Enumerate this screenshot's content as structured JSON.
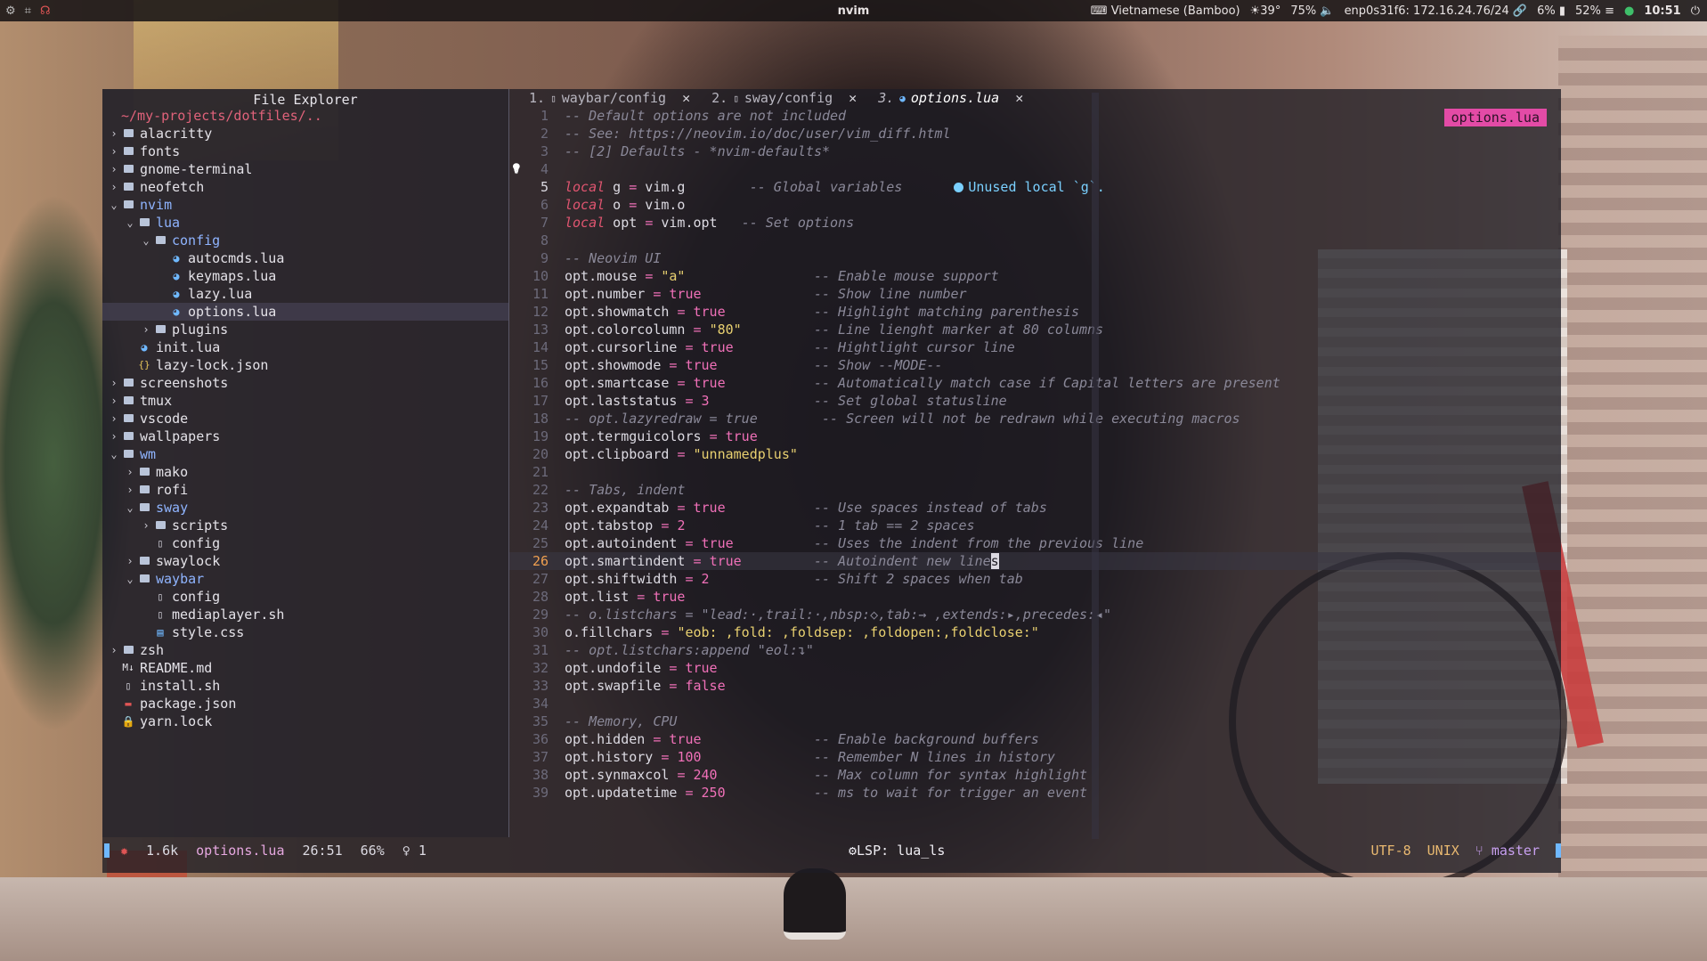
{
  "topbar": {
    "title": "nvim",
    "keyboard": "Vietnamese (Bamboo)",
    "weather": "☀39°",
    "volume": "75%",
    "network": "enp0s31f6: 172.16.24.76/24",
    "cpu": "6%",
    "battery": "52%",
    "clock": "10:51"
  },
  "explorer": {
    "title": "File Explorer",
    "path": "~/my-projects/dotfiles/..",
    "items": [
      {
        "name": "alacritty",
        "type": "dir",
        "open": false,
        "depth": 0
      },
      {
        "name": "fonts",
        "type": "dir",
        "open": false,
        "depth": 0
      },
      {
        "name": "gnome-terminal",
        "type": "dir",
        "open": false,
        "depth": 0
      },
      {
        "name": "neofetch",
        "type": "dir",
        "open": false,
        "depth": 0
      },
      {
        "name": "nvim",
        "type": "dir",
        "open": true,
        "depth": 0
      },
      {
        "name": "lua",
        "type": "dir",
        "open": true,
        "depth": 1
      },
      {
        "name": "config",
        "type": "dir",
        "open": true,
        "depth": 2
      },
      {
        "name": "autocmds.lua",
        "type": "lua",
        "depth": 3
      },
      {
        "name": "keymaps.lua",
        "type": "lua",
        "depth": 3
      },
      {
        "name": "lazy.lua",
        "type": "lua",
        "depth": 3
      },
      {
        "name": "options.lua",
        "type": "lua",
        "depth": 3,
        "active": true
      },
      {
        "name": "plugins",
        "type": "dir",
        "open": false,
        "depth": 2
      },
      {
        "name": "init.lua",
        "type": "lua",
        "depth": 1
      },
      {
        "name": "lazy-lock.json",
        "type": "json",
        "depth": 1
      },
      {
        "name": "screenshots",
        "type": "dir",
        "open": false,
        "depth": 0
      },
      {
        "name": "tmux",
        "type": "dir",
        "open": false,
        "depth": 0
      },
      {
        "name": "vscode",
        "type": "dir",
        "open": false,
        "depth": 0
      },
      {
        "name": "wallpapers",
        "type": "dir",
        "open": false,
        "depth": 0
      },
      {
        "name": "wm",
        "type": "dir",
        "open": true,
        "depth": 0
      },
      {
        "name": "mako",
        "type": "dir",
        "open": false,
        "depth": 1
      },
      {
        "name": "rofi",
        "type": "dir",
        "open": false,
        "depth": 1
      },
      {
        "name": "sway",
        "type": "dir",
        "open": true,
        "depth": 1
      },
      {
        "name": "scripts",
        "type": "dir",
        "open": false,
        "depth": 2
      },
      {
        "name": "config",
        "type": "file",
        "depth": 2
      },
      {
        "name": "swaylock",
        "type": "dir",
        "open": false,
        "depth": 1
      },
      {
        "name": "waybar",
        "type": "dir",
        "open": true,
        "depth": 1
      },
      {
        "name": "config",
        "type": "file",
        "depth": 2
      },
      {
        "name": "mediaplayer.sh",
        "type": "file",
        "depth": 2
      },
      {
        "name": "style.css",
        "type": "css",
        "depth": 2
      },
      {
        "name": "zsh",
        "type": "dir",
        "open": false,
        "depth": 0
      },
      {
        "name": "README.md",
        "type": "md",
        "depth": 0
      },
      {
        "name": "install.sh",
        "type": "file",
        "depth": 0
      },
      {
        "name": "package.json",
        "type": "npm",
        "depth": 0
      },
      {
        "name": "yarn.lock",
        "type": "lock",
        "depth": 0
      }
    ]
  },
  "tabs": [
    {
      "num": "1.",
      "label": "waybar/config",
      "close": "✕",
      "active": false
    },
    {
      "num": "2.",
      "label": "sway/config",
      "close": "✕",
      "active": false
    },
    {
      "num": "3.",
      "label": "options.lua",
      "close": "✕",
      "active": true
    }
  ],
  "badge": "options.lua",
  "diagnostic": "Unused local `g`.",
  "code": [
    {
      "n": "1",
      "t": [
        [
          "cm",
          "-- Default options are not included"
        ]
      ]
    },
    {
      "n": "2",
      "t": [
        [
          "cm",
          "-- See: https://neovim.io/doc/user/vim_diff.html"
        ]
      ]
    },
    {
      "n": "3",
      "t": [
        [
          "cm",
          "-- [2] Defaults - *nvim-defaults*"
        ]
      ]
    },
    {
      "n": "4",
      "t": []
    },
    {
      "n": "5",
      "t": [
        [
          "kw",
          "local"
        ],
        [
          "tx",
          " g "
        ],
        [
          "op",
          "="
        ],
        [
          "tx",
          " vim.g        "
        ],
        [
          "cm",
          "-- Global variables"
        ]
      ],
      "diag": true
    },
    {
      "n": "6",
      "t": [
        [
          "kw",
          "local"
        ],
        [
          "tx",
          " o "
        ],
        [
          "op",
          "="
        ],
        [
          "tx",
          " vim.o"
        ]
      ]
    },
    {
      "n": "7",
      "t": [
        [
          "kw",
          "local"
        ],
        [
          "tx",
          " opt "
        ],
        [
          "op",
          "="
        ],
        [
          "tx",
          " vim.opt   "
        ],
        [
          "cm",
          "-- Set options"
        ]
      ]
    },
    {
      "n": "8",
      "t": []
    },
    {
      "n": "9",
      "t": [
        [
          "cm",
          "-- Neovim UI"
        ]
      ]
    },
    {
      "n": "10",
      "t": [
        [
          "tx",
          "opt.mouse "
        ],
        [
          "op",
          "="
        ],
        [
          "tx",
          " "
        ],
        [
          "str",
          "\"a\""
        ],
        [
          "tx",
          "                "
        ],
        [
          "cm",
          "-- Enable mouse support"
        ]
      ]
    },
    {
      "n": "11",
      "t": [
        [
          "tx",
          "opt.number "
        ],
        [
          "op",
          "="
        ],
        [
          "tx",
          " "
        ],
        [
          "bool",
          "true"
        ],
        [
          "tx",
          "              "
        ],
        [
          "cm",
          "-- Show line number"
        ]
      ]
    },
    {
      "n": "12",
      "t": [
        [
          "tx",
          "opt.showmatch "
        ],
        [
          "op",
          "="
        ],
        [
          "tx",
          " "
        ],
        [
          "bool",
          "true"
        ],
        [
          "tx",
          "           "
        ],
        [
          "cm",
          "-- Highlight matching parenthesis"
        ]
      ]
    },
    {
      "n": "13",
      "t": [
        [
          "tx",
          "opt.colorcolumn "
        ],
        [
          "op",
          "="
        ],
        [
          "tx",
          " "
        ],
        [
          "str",
          "\"80\""
        ],
        [
          "tx",
          "         "
        ],
        [
          "cm",
          "-- Line lienght marker at 80 columns"
        ]
      ]
    },
    {
      "n": "14",
      "t": [
        [
          "tx",
          "opt.cursorline "
        ],
        [
          "op",
          "="
        ],
        [
          "tx",
          " "
        ],
        [
          "bool",
          "true"
        ],
        [
          "tx",
          "          "
        ],
        [
          "cm",
          "-- Hightlight cursor line"
        ]
      ]
    },
    {
      "n": "15",
      "t": [
        [
          "tx",
          "opt.showmode "
        ],
        [
          "op",
          "="
        ],
        [
          "tx",
          " "
        ],
        [
          "bool",
          "true"
        ],
        [
          "tx",
          "            "
        ],
        [
          "cm",
          "-- Show --MODE--"
        ]
      ]
    },
    {
      "n": "16",
      "t": [
        [
          "tx",
          "opt.smartcase "
        ],
        [
          "op",
          "="
        ],
        [
          "tx",
          " "
        ],
        [
          "bool",
          "true"
        ],
        [
          "tx",
          "           "
        ],
        [
          "cm",
          "-- Automatically match case if Capital letters are present"
        ]
      ]
    },
    {
      "n": "17",
      "t": [
        [
          "tx",
          "opt.laststatus "
        ],
        [
          "op",
          "="
        ],
        [
          "tx",
          " "
        ],
        [
          "num",
          "3"
        ],
        [
          "tx",
          "             "
        ],
        [
          "cm",
          "-- Set global statusline"
        ]
      ]
    },
    {
      "n": "18",
      "t": [
        [
          "cm",
          "-- opt.lazyredraw = true        -- Screen will not be redrawn while executing macros"
        ]
      ]
    },
    {
      "n": "19",
      "t": [
        [
          "tx",
          "opt.termguicolors "
        ],
        [
          "op",
          "="
        ],
        [
          "tx",
          " "
        ],
        [
          "bool",
          "true"
        ]
      ]
    },
    {
      "n": "20",
      "t": [
        [
          "tx",
          "opt.clipboard "
        ],
        [
          "op",
          "="
        ],
        [
          "tx",
          " "
        ],
        [
          "str",
          "\"unnamedplus\""
        ]
      ]
    },
    {
      "n": "21",
      "t": []
    },
    {
      "n": "22",
      "t": [
        [
          "cm",
          "-- Tabs, indent"
        ]
      ]
    },
    {
      "n": "23",
      "t": [
        [
          "tx",
          "opt.expandtab "
        ],
        [
          "op",
          "="
        ],
        [
          "tx",
          " "
        ],
        [
          "bool",
          "true"
        ],
        [
          "tx",
          "           "
        ],
        [
          "cm",
          "-- Use spaces instead of tabs"
        ]
      ]
    },
    {
      "n": "24",
      "t": [
        [
          "tx",
          "opt.tabstop "
        ],
        [
          "op",
          "="
        ],
        [
          "tx",
          " "
        ],
        [
          "num",
          "2"
        ],
        [
          "tx",
          "                "
        ],
        [
          "cm",
          "-- 1 tab == 2 spaces"
        ]
      ]
    },
    {
      "n": "25",
      "t": [
        [
          "tx",
          "opt.autoindent "
        ],
        [
          "op",
          "="
        ],
        [
          "tx",
          " "
        ],
        [
          "bool",
          "true"
        ],
        [
          "tx",
          "          "
        ],
        [
          "cm",
          "-- Uses the indent from the previous line"
        ]
      ]
    },
    {
      "n": "26",
      "t": [
        [
          "tx",
          "opt.smartindent "
        ],
        [
          "op",
          "="
        ],
        [
          "tx",
          " "
        ],
        [
          "bool",
          "true"
        ],
        [
          "tx",
          "         "
        ],
        [
          "cm",
          "-- Autoindent new line"
        ],
        [
          "cur",
          "s"
        ]
      ],
      "cursor": true
    },
    {
      "n": "27",
      "t": [
        [
          "tx",
          "opt.shiftwidth "
        ],
        [
          "op",
          "="
        ],
        [
          "tx",
          " "
        ],
        [
          "num",
          "2"
        ],
        [
          "tx",
          "             "
        ],
        [
          "cm",
          "-- Shift 2 spaces when tab"
        ]
      ]
    },
    {
      "n": "28",
      "t": [
        [
          "tx",
          "opt.list "
        ],
        [
          "op",
          "="
        ],
        [
          "tx",
          " "
        ],
        [
          "bool",
          "true"
        ]
      ]
    },
    {
      "n": "29",
      "t": [
        [
          "cm",
          "-- o.listchars = \"lead:·,trail:·,nbsp:◇,tab:→ ,extends:▸,precedes:◂\""
        ]
      ]
    },
    {
      "n": "30",
      "t": [
        [
          "tx",
          "o.fillchars "
        ],
        [
          "op",
          "="
        ],
        [
          "tx",
          " "
        ],
        [
          "str",
          "\"eob: ,fold: ,foldsep: ,foldopen:,foldclose:\""
        ]
      ]
    },
    {
      "n": "31",
      "t": [
        [
          "cm",
          "-- opt.listchars:append \"eol:↴\""
        ]
      ]
    },
    {
      "n": "32",
      "t": [
        [
          "tx",
          "opt.undofile "
        ],
        [
          "op",
          "="
        ],
        [
          "tx",
          " "
        ],
        [
          "bool",
          "true"
        ]
      ]
    },
    {
      "n": "33",
      "t": [
        [
          "tx",
          "opt.swapfile "
        ],
        [
          "op",
          "="
        ],
        [
          "tx",
          " "
        ],
        [
          "bool",
          "false"
        ]
      ]
    },
    {
      "n": "34",
      "t": []
    },
    {
      "n": "35",
      "t": [
        [
          "cm",
          "-- Memory, CPU"
        ]
      ]
    },
    {
      "n": "36",
      "t": [
        [
          "tx",
          "opt.hidden "
        ],
        [
          "op",
          "="
        ],
        [
          "tx",
          " "
        ],
        [
          "bool",
          "true"
        ],
        [
          "tx",
          "              "
        ],
        [
          "cm",
          "-- Enable background buffers"
        ]
      ]
    },
    {
      "n": "37",
      "t": [
        [
          "tx",
          "opt.history "
        ],
        [
          "op",
          "="
        ],
        [
          "tx",
          " "
        ],
        [
          "num",
          "100"
        ],
        [
          "tx",
          "              "
        ],
        [
          "cm",
          "-- Remember N lines in history"
        ]
      ]
    },
    {
      "n": "38",
      "t": [
        [
          "tx",
          "opt.synmaxcol "
        ],
        [
          "op",
          "="
        ],
        [
          "tx",
          " "
        ],
        [
          "num",
          "240"
        ],
        [
          "tx",
          "            "
        ],
        [
          "cm",
          "-- Max column for syntax highlight"
        ]
      ]
    },
    {
      "n": "39",
      "t": [
        [
          "tx",
          "opt.updatetime "
        ],
        [
          "op",
          "="
        ],
        [
          "tx",
          " "
        ],
        [
          "num",
          "250"
        ],
        [
          "tx",
          "           "
        ],
        [
          "cm",
          "-- ms to wait for trigger an event"
        ]
      ]
    }
  ],
  "statusline": {
    "size": "1.6k",
    "filename": "options.lua",
    "position": "26:51",
    "percent": "66%",
    "hints": "1",
    "lsp": "LSP: lua_ls",
    "encoding": "UTF-8",
    "format": "UNIX",
    "branch": "master"
  }
}
